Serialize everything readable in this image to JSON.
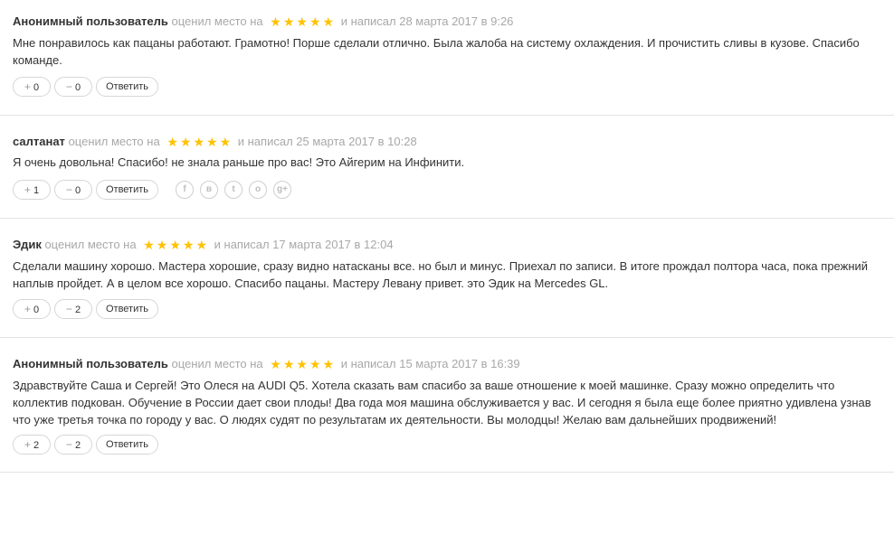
{
  "colors": {
    "star": "#ffc200",
    "muted": "#a8a8a8",
    "text": "#333333",
    "divider": "#e4e4e4"
  },
  "reviews": [
    {
      "author": "Анонимный пользователь",
      "rated_text": "оценил место на",
      "stars": 5,
      "wrote_text": "и написал 28 марта 2017 в 9:26",
      "text": "Мне понравилось как пацаны работают. Грамотно! Порше сделали отлично. Была жалоба на систему охлаждения. И прочистить сливы в кузове. Спасибо команде.",
      "likes": "0",
      "dislikes": "0",
      "reply_label": "Ответить",
      "social_icons": []
    },
    {
      "author": "салтанат",
      "rated_text": "оценил место на",
      "stars": 5,
      "wrote_text": "и написал 25 марта 2017 в 10:28",
      "text": "Я очень довольна! Спасибо! не знала раньше про вас! Это Айгерим на Инфинити.",
      "likes": "1",
      "dislikes": "0",
      "reply_label": "Ответить",
      "social_icons": [
        "facebook-icon",
        "vkontakte-icon",
        "twitter-icon",
        "odnoklassniki-icon",
        "google-plus-icon"
      ]
    },
    {
      "author": "Эдик",
      "rated_text": "оценил место на",
      "stars": 5,
      "wrote_text": "и написал 17 марта 2017 в 12:04",
      "text": "Сделали машину хорошо. Мастера хорошие, сразу видно натасканы все. но был и минус. Приехал по записи. В итоге прождал полтора часа, пока прежний наплыв пройдет. А в целом все хорошо. Спасибо пацаны. Мастеру Левану привет. это Эдик на Mercedes GL.",
      "likes": "0",
      "dislikes": "2",
      "reply_label": "Ответить",
      "social_icons": []
    },
    {
      "author": "Анонимный пользователь",
      "rated_text": "оценил место на",
      "stars": 5,
      "wrote_text": "и написал 15 марта 2017 в 16:39",
      "text": "Здравствуйте Саша и Сергей! Это Олеся на AUDI Q5. Хотела сказать вам спасибо за ваше отношение к моей машинке. Сразу можно определить что коллектив подкован. Обучение в России дает свои плоды! Два года моя машина обслуживается у вас. И сегодня я была еще более приятно удивлена узнав что уже третья точка по городу у вас. О людях судят по результатам их деятельности. Вы молодцы! Желаю вам дальнейших продвижений!",
      "likes": "2",
      "dislikes": "2",
      "reply_label": "Ответить",
      "social_icons": []
    }
  ]
}
